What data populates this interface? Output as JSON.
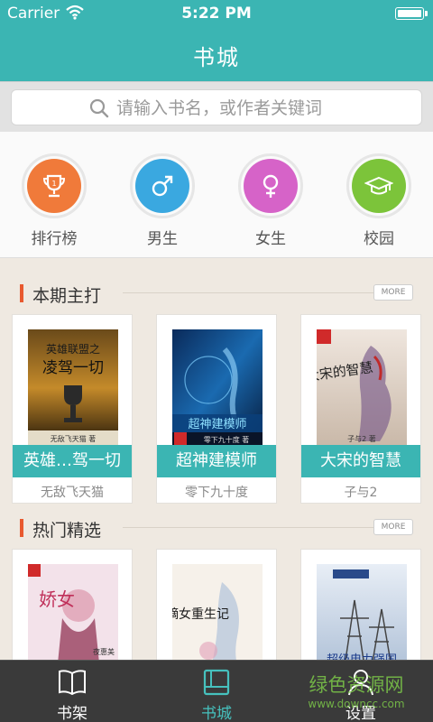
{
  "status": {
    "carrier": "Carrier",
    "time": "5:22 PM"
  },
  "nav": {
    "title": "书城"
  },
  "search": {
    "placeholder": "请输入书名，或作者关键词"
  },
  "categories": [
    {
      "label": "排行榜",
      "icon": "trophy-icon",
      "color": "#f07a3a"
    },
    {
      "label": "男生",
      "icon": "male-icon",
      "color": "#3aa8e0"
    },
    {
      "label": "女生",
      "icon": "female-icon",
      "color": "#d663c8"
    },
    {
      "label": "校园",
      "icon": "graduation-cap-icon",
      "color": "#7cc43a"
    }
  ],
  "sections": [
    {
      "title": "本期主打",
      "more": "MORE",
      "books": [
        {
          "title": "英雄…驾一切",
          "author": "无敌飞天猫",
          "cover_title": "英雄联盟之",
          "cover_subtitle": "凌驾一切",
          "cover_author": "无敌飞天猫 著"
        },
        {
          "title": "超神建模师",
          "author": "零下九十度",
          "cover_title": "超神建模师",
          "cover_author": "零下九十度 著"
        },
        {
          "title": "大宋的智慧",
          "author": "子与2",
          "cover_title": "大宋的智慧",
          "cover_author": "子与2 著"
        }
      ]
    },
    {
      "title": "热门精选",
      "more": "MORE",
      "books": [
        {
          "cover_title": "娇女",
          "cover_author": "夜惠美"
        },
        {
          "cover_title": "嫡女重生记"
        },
        {
          "cover_title": "超级电力强国"
        }
      ]
    }
  ],
  "tabs": [
    {
      "label": "书架",
      "icon": "book-icon"
    },
    {
      "label": "书城",
      "icon": "bookstore-icon"
    },
    {
      "label": "设置",
      "icon": "person-icon"
    }
  ],
  "watermark": {
    "text": "绿色资源网",
    "url": "www.downcc.com"
  },
  "colors": {
    "primary": "#3bb5b3",
    "accent": "#e8592f",
    "tab_bar": "#3a3a3a"
  }
}
